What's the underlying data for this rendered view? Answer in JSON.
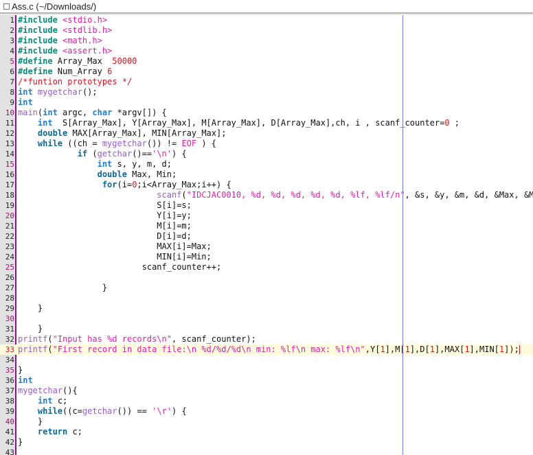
{
  "window": {
    "title": "Ass.c (~/Downloads/)"
  },
  "editor": {
    "current_line": 33,
    "lines": [
      {
        "n": "1",
        "tokens": [
          {
            "t": "pp",
            "v": "#include"
          },
          {
            "t": "",
            "v": " "
          },
          {
            "t": "str",
            "v": "<stdio.h>"
          }
        ]
      },
      {
        "n": "2",
        "tokens": [
          {
            "t": "pp",
            "v": "#include"
          },
          {
            "t": "",
            "v": " "
          },
          {
            "t": "str",
            "v": "<stdlib.h>"
          }
        ]
      },
      {
        "n": "3",
        "tokens": [
          {
            "t": "pp",
            "v": "#include"
          },
          {
            "t": "",
            "v": " "
          },
          {
            "t": "str",
            "v": "<math.h>"
          }
        ]
      },
      {
        "n": "4",
        "tokens": [
          {
            "t": "pp",
            "v": "#include"
          },
          {
            "t": "",
            "v": " "
          },
          {
            "t": "str",
            "v": "<assert.h>"
          }
        ]
      },
      {
        "n": "5",
        "tokens": [
          {
            "t": "pp",
            "v": "#define"
          },
          {
            "t": "",
            "v": " Array_Max  "
          },
          {
            "t": "num",
            "v": "50000"
          }
        ]
      },
      {
        "n": "6",
        "tokens": [
          {
            "t": "pp",
            "v": "#define"
          },
          {
            "t": "",
            "v": " Num_Array "
          },
          {
            "t": "num",
            "v": "6"
          }
        ]
      },
      {
        "n": "7",
        "tokens": [
          {
            "t": "cm",
            "v": "/*funtion prototypes */"
          }
        ]
      },
      {
        "n": "8",
        "tokens": [
          {
            "t": "k1",
            "v": "int"
          },
          {
            "t": "",
            "v": " "
          },
          {
            "t": "fn",
            "v": "mygetchar"
          },
          {
            "t": "",
            "v": "();"
          }
        ]
      },
      {
        "n": "9",
        "tokens": [
          {
            "t": "k1",
            "v": "int"
          }
        ]
      },
      {
        "n": "10",
        "tokens": [
          {
            "t": "fn",
            "v": "main"
          },
          {
            "t": "",
            "v": "("
          },
          {
            "t": "k1",
            "v": "int"
          },
          {
            "t": "",
            "v": " argc, "
          },
          {
            "t": "k1",
            "v": "char"
          },
          {
            "t": "",
            "v": " *argv[]) {"
          }
        ]
      },
      {
        "n": "11",
        "tokens": [
          {
            "t": "",
            "v": "    "
          },
          {
            "t": "k1",
            "v": "int"
          },
          {
            "t": "",
            "v": "  S[Array_Max], Y[Array_Max], M[Array_Max], D[Array_Max],ch, i , scanf_counter="
          },
          {
            "t": "num",
            "v": "0"
          },
          {
            "t": "",
            "v": " ;"
          }
        ]
      },
      {
        "n": "12",
        "tokens": [
          {
            "t": "",
            "v": "    "
          },
          {
            "t": "k2",
            "v": "double"
          },
          {
            "t": "",
            "v": " MAX[Array_Max], MIN[Array_Max];"
          }
        ]
      },
      {
        "n": "13",
        "tokens": [
          {
            "t": "",
            "v": "    "
          },
          {
            "t": "k2",
            "v": "while"
          },
          {
            "t": "",
            "v": " ((ch = "
          },
          {
            "t": "fn",
            "v": "mygetchar"
          },
          {
            "t": "",
            "v": "()) != "
          },
          {
            "t": "str",
            "v": "EOF"
          },
          {
            "t": "",
            "v": " ) {"
          }
        ]
      },
      {
        "n": "14",
        "tokens": [
          {
            "t": "",
            "v": "            "
          },
          {
            "t": "k2",
            "v": "if"
          },
          {
            "t": "",
            "v": " ("
          },
          {
            "t": "fn",
            "v": "getchar"
          },
          {
            "t": "",
            "v": "()=="
          },
          {
            "t": "str",
            "v": "'\\n'"
          },
          {
            "t": "",
            "v": ") {"
          }
        ]
      },
      {
        "n": "15",
        "tokens": [
          {
            "t": "",
            "v": "                "
          },
          {
            "t": "k1",
            "v": "int"
          },
          {
            "t": "",
            "v": " s, y, m, d;"
          }
        ]
      },
      {
        "n": "16",
        "tokens": [
          {
            "t": "",
            "v": "                "
          },
          {
            "t": "k2",
            "v": "double"
          },
          {
            "t": "",
            "v": " Max, Min;"
          }
        ]
      },
      {
        "n": "17",
        "tokens": [
          {
            "t": "",
            "v": "                 "
          },
          {
            "t": "k2",
            "v": "for"
          },
          {
            "t": "",
            "v": "(i="
          },
          {
            "t": "num",
            "v": "0"
          },
          {
            "t": "",
            "v": ";i<Array_Max;i++) {"
          }
        ]
      },
      {
        "n": "18",
        "tokens": [
          {
            "t": "",
            "v": "                            "
          },
          {
            "t": "fn",
            "v": "scanf"
          },
          {
            "t": "",
            "v": "("
          },
          {
            "t": "str",
            "v": "\"IDCJAC0010, %d, %d, %d, %d, %d, %lf, %lf/n\""
          },
          {
            "t": "",
            "v": ", &s, &y, &m, &d, &Max, &Min);"
          }
        ]
      },
      {
        "n": "19",
        "tokens": [
          {
            "t": "",
            "v": "                            S[i]=s;"
          }
        ]
      },
      {
        "n": "20",
        "tokens": [
          {
            "t": "",
            "v": "                            Y[i]=y;"
          }
        ]
      },
      {
        "n": "21",
        "tokens": [
          {
            "t": "",
            "v": "                            M[i]=m;"
          }
        ]
      },
      {
        "n": "22",
        "tokens": [
          {
            "t": "",
            "v": "                            D[i]=d;"
          }
        ]
      },
      {
        "n": "23",
        "tokens": [
          {
            "t": "",
            "v": "                            MAX[i]=Max;"
          }
        ]
      },
      {
        "n": "24",
        "tokens": [
          {
            "t": "",
            "v": "                            MIN[i]=Min;"
          }
        ]
      },
      {
        "n": "25",
        "tokens": [
          {
            "t": "",
            "v": "                         scanf_counter++;"
          }
        ]
      },
      {
        "n": "26",
        "tokens": []
      },
      {
        "n": "27",
        "tokens": [
          {
            "t": "",
            "v": "                 }"
          }
        ]
      },
      {
        "n": "28",
        "tokens": []
      },
      {
        "n": "29",
        "tokens": [
          {
            "t": "",
            "v": "    }"
          }
        ]
      },
      {
        "n": "30",
        "tokens": []
      },
      {
        "n": "31",
        "tokens": [
          {
            "t": "",
            "v": "    }"
          }
        ]
      },
      {
        "n": "32",
        "tokens": [
          {
            "t": "fn",
            "v": "printf"
          },
          {
            "t": "",
            "v": "("
          },
          {
            "t": "str",
            "v": "\"Input has %d records\\n\""
          },
          {
            "t": "",
            "v": ", scanf_counter);"
          }
        ]
      },
      {
        "n": "33",
        "tokens": [
          {
            "t": "fn",
            "v": "printf"
          },
          {
            "t": "",
            "v": "("
          },
          {
            "t": "str",
            "v": "\"First record in data file:\\n %d/%d/%d\\n min: %lf\\n max: %lf\\n\""
          },
          {
            "t": "",
            "v": ",Y["
          },
          {
            "t": "num",
            "v": "1"
          },
          {
            "t": "",
            "v": "],M["
          },
          {
            "t": "num",
            "v": "1"
          },
          {
            "t": "",
            "v": "],D["
          },
          {
            "t": "num",
            "v": "1"
          },
          {
            "t": "",
            "v": "],MAX["
          },
          {
            "t": "num",
            "v": "1"
          },
          {
            "t": "",
            "v": "],MIN["
          },
          {
            "t": "num",
            "v": "1"
          },
          {
            "t": "",
            "v": "]);"
          }
        ]
      },
      {
        "n": "34",
        "tokens": []
      },
      {
        "n": "35",
        "tokens": [
          {
            "t": "",
            "v": "}"
          }
        ]
      },
      {
        "n": "36",
        "tokens": [
          {
            "t": "k1",
            "v": "int"
          }
        ]
      },
      {
        "n": "37",
        "tokens": [
          {
            "t": "fn",
            "v": "mygetchar"
          },
          {
            "t": "",
            "v": "(){"
          }
        ]
      },
      {
        "n": "38",
        "tokens": [
          {
            "t": "",
            "v": "    "
          },
          {
            "t": "k1",
            "v": "int"
          },
          {
            "t": "",
            "v": " c;"
          }
        ]
      },
      {
        "n": "39",
        "tokens": [
          {
            "t": "",
            "v": "    "
          },
          {
            "t": "k2",
            "v": "while"
          },
          {
            "t": "",
            "v": "((c="
          },
          {
            "t": "fn",
            "v": "getchar"
          },
          {
            "t": "",
            "v": "()) == "
          },
          {
            "t": "str",
            "v": "'\\r'"
          },
          {
            "t": "",
            "v": ") {"
          }
        ]
      },
      {
        "n": "40",
        "tokens": [
          {
            "t": "",
            "v": "    }"
          }
        ]
      },
      {
        "n": "41",
        "tokens": [
          {
            "t": "",
            "v": "    "
          },
          {
            "t": "k2",
            "v": "return"
          },
          {
            "t": "",
            "v": " c;"
          }
        ]
      },
      {
        "n": "42",
        "tokens": [
          {
            "t": "",
            "v": "}"
          }
        ]
      },
      {
        "n": "43",
        "tokens": []
      }
    ]
  }
}
